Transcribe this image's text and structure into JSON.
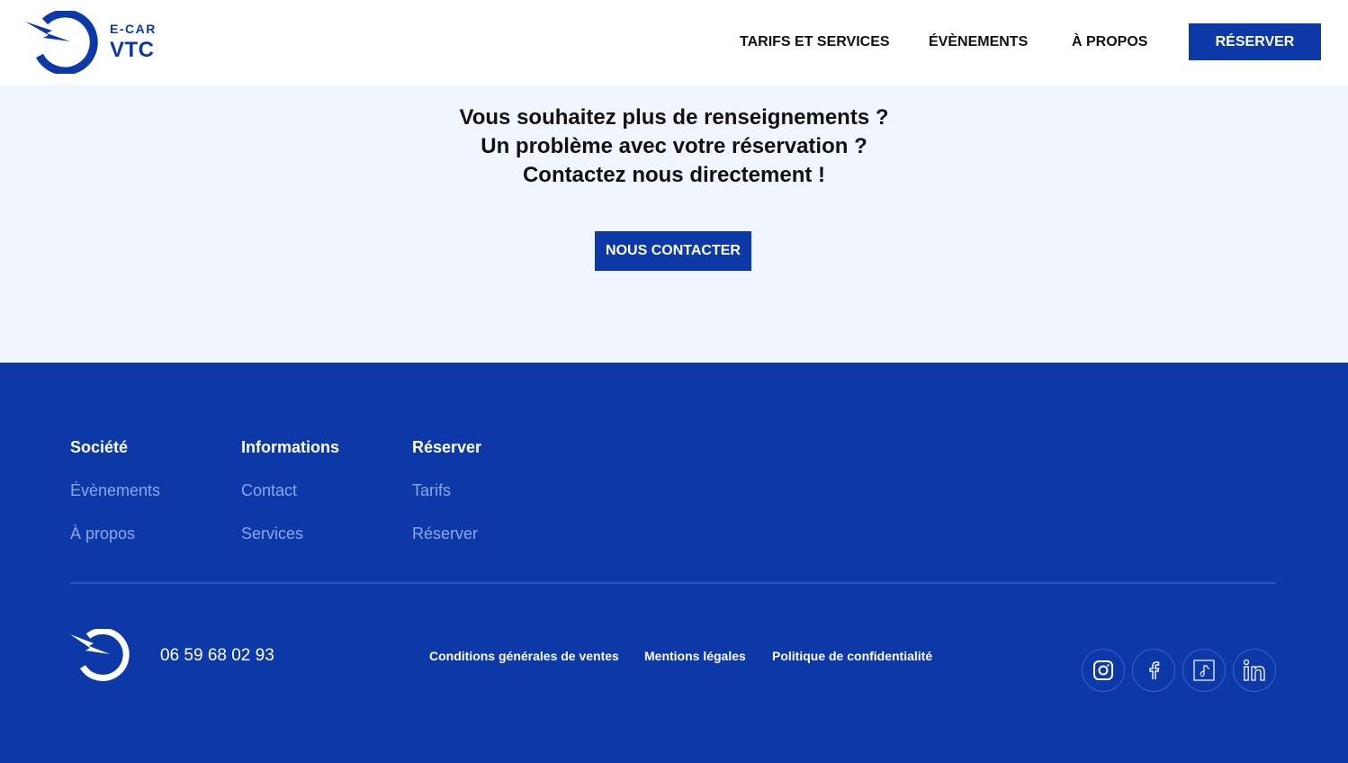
{
  "brand": {
    "name_top": "E-CAR",
    "name_bottom": "VTC",
    "primary_color": "#0c38a8",
    "background_tint": "#f1f5fd"
  },
  "header": {
    "nav": [
      {
        "label": "TARIFS ET SERVICES"
      },
      {
        "label": "ÉVÈNEMENTS"
      },
      {
        "label": "À PROPOS"
      }
    ],
    "cta_label": "RÉSERVER"
  },
  "contact": {
    "lines": [
      "Vous souhaitez plus de renseignements ?",
      "Un problème avec votre réservation ?",
      "Contactez nous directement !"
    ],
    "button_label": "NOUS CONTACTER"
  },
  "footer": {
    "columns": [
      {
        "title": "Société",
        "links": [
          "Évènements",
          "À propos"
        ]
      },
      {
        "title": "Informations",
        "links": [
          "Contact",
          "Services"
        ]
      },
      {
        "title": "Réserver",
        "links": [
          "Tarifs",
          "Réserver"
        ]
      }
    ],
    "phone": "06 59 68 02 93",
    "legal_links": [
      "Conditions générales de ventes",
      "Mentions légales",
      "Politique de confidentialité"
    ],
    "social_icons": [
      "instagram-icon",
      "facebook-icon",
      "tiktok-icon",
      "linkedin-icon"
    ]
  }
}
